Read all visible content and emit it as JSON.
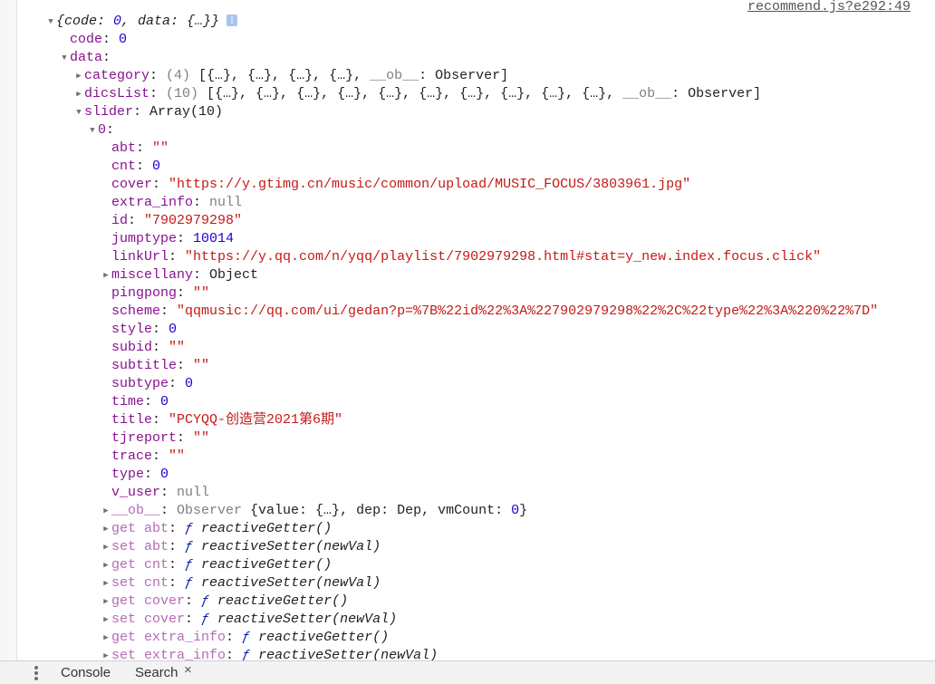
{
  "source_link": "recommend.js?e292:49",
  "rows": [
    {
      "level": 0,
      "toggle": "open",
      "info": true,
      "tokens": [
        [
          "{code: ",
          "it"
        ],
        [
          "0",
          "itnum"
        ],
        [
          ", data: {…}}",
          "it"
        ]
      ]
    },
    {
      "level": 1,
      "toggle": "none",
      "key": "code",
      "tokens": [
        [
          "0",
          "num"
        ]
      ]
    },
    {
      "level": 1,
      "toggle": "open",
      "key": "data",
      "tokens": []
    },
    {
      "level": 2,
      "toggle": "closed",
      "key": "category",
      "tokens": [
        [
          "(4)",
          "gray"
        ],
        [
          " [{…}, {…}, {…}, {…}, ",
          "plain"
        ],
        [
          "__ob__",
          "gray"
        ],
        [
          ": Observer]",
          "plain"
        ]
      ]
    },
    {
      "level": 2,
      "toggle": "closed",
      "key": "dicsList",
      "tokens": [
        [
          "(10)",
          "gray"
        ],
        [
          " [{…}, {…}, {…}, {…}, {…}, {…}, {…}, {…}, {…}, {…}, ",
          "plain"
        ],
        [
          "__ob__",
          "gray"
        ],
        [
          ": Observer]",
          "plain"
        ]
      ]
    },
    {
      "level": 2,
      "toggle": "open",
      "key": "slider",
      "tokens": [
        [
          "Array(10)",
          "plain"
        ]
      ]
    },
    {
      "level": 3,
      "toggle": "open",
      "key": "0",
      "tokens": []
    },
    {
      "level": 4,
      "toggle": "none",
      "key": "abt",
      "tokens": [
        [
          "\"\"",
          "str"
        ]
      ]
    },
    {
      "level": 4,
      "toggle": "none",
      "key": "cnt",
      "tokens": [
        [
          "0",
          "num"
        ]
      ]
    },
    {
      "level": 4,
      "toggle": "none",
      "key": "cover",
      "tokens": [
        [
          "\"https://y.gtimg.cn/music/common/upload/MUSIC_FOCUS/3803961.jpg\"",
          "str"
        ]
      ]
    },
    {
      "level": 4,
      "toggle": "none",
      "key": "extra_info",
      "tokens": [
        [
          "null",
          "null"
        ]
      ]
    },
    {
      "level": 4,
      "toggle": "none",
      "key": "id",
      "tokens": [
        [
          "\"7902979298\"",
          "str"
        ]
      ]
    },
    {
      "level": 4,
      "toggle": "none",
      "key": "jumptype",
      "tokens": [
        [
          "10014",
          "num"
        ]
      ]
    },
    {
      "level": 4,
      "toggle": "none",
      "key": "linkUrl",
      "tokens": [
        [
          "\"https://y.qq.com/n/yqq/playlist/7902979298.html#stat=y_new.index.focus.click\"",
          "str"
        ]
      ]
    },
    {
      "level": 4,
      "toggle": "closed",
      "key": "miscellany",
      "tokens": [
        [
          "Object",
          "plain"
        ]
      ]
    },
    {
      "level": 4,
      "toggle": "none",
      "key": "pingpong",
      "tokens": [
        [
          "\"\"",
          "str"
        ]
      ]
    },
    {
      "level": 4,
      "toggle": "none",
      "key": "scheme",
      "tokens": [
        [
          "\"qqmusic://qq.com/ui/gedan?p=%7B%22id%22%3A%227902979298%22%2C%22type%22%3A%220%22%7D\"",
          "str"
        ]
      ]
    },
    {
      "level": 4,
      "toggle": "none",
      "key": "style",
      "tokens": [
        [
          "0",
          "num"
        ]
      ]
    },
    {
      "level": 4,
      "toggle": "none",
      "key": "subid",
      "tokens": [
        [
          "\"\"",
          "str"
        ]
      ]
    },
    {
      "level": 4,
      "toggle": "none",
      "key": "subtitle",
      "tokens": [
        [
          "\"\"",
          "str"
        ]
      ]
    },
    {
      "level": 4,
      "toggle": "none",
      "key": "subtype",
      "tokens": [
        [
          "0",
          "num"
        ]
      ]
    },
    {
      "level": 4,
      "toggle": "none",
      "key": "time",
      "tokens": [
        [
          "0",
          "num"
        ]
      ]
    },
    {
      "level": 4,
      "toggle": "none",
      "key": "title",
      "tokens": [
        [
          "\"PCYQQ-创造营2021第6期\"",
          "str"
        ]
      ]
    },
    {
      "level": 4,
      "toggle": "none",
      "key": "tjreport",
      "tokens": [
        [
          "\"\"",
          "str"
        ]
      ]
    },
    {
      "level": 4,
      "toggle": "none",
      "key": "trace",
      "tokens": [
        [
          "\"\"",
          "str"
        ]
      ]
    },
    {
      "level": 4,
      "toggle": "none",
      "key": "type",
      "tokens": [
        [
          "0",
          "num"
        ]
      ]
    },
    {
      "level": 4,
      "toggle": "none",
      "key": "v_user",
      "tokens": [
        [
          "null",
          "null"
        ]
      ]
    },
    {
      "level": 4,
      "toggle": "closed",
      "key": "__ob__",
      "dim": true,
      "tokens": [
        [
          "Observer ",
          "gray"
        ],
        [
          "{value: {…}, dep: Dep, vmCount: ",
          "plain"
        ],
        [
          "0",
          "num"
        ],
        [
          "}",
          "plain"
        ]
      ]
    },
    {
      "level": 4,
      "toggle": "closed",
      "key": "get abt",
      "dim": true,
      "tokens": [
        [
          "ƒ ",
          "fn"
        ],
        [
          "reactiveGetter()",
          "it"
        ]
      ]
    },
    {
      "level": 4,
      "toggle": "closed",
      "key": "set abt",
      "dim": true,
      "tokens": [
        [
          "ƒ ",
          "fn"
        ],
        [
          "reactiveSetter(newVal)",
          "it"
        ]
      ]
    },
    {
      "level": 4,
      "toggle": "closed",
      "key": "get cnt",
      "dim": true,
      "tokens": [
        [
          "ƒ ",
          "fn"
        ],
        [
          "reactiveGetter()",
          "it"
        ]
      ]
    },
    {
      "level": 4,
      "toggle": "closed",
      "key": "set cnt",
      "dim": true,
      "tokens": [
        [
          "ƒ ",
          "fn"
        ],
        [
          "reactiveSetter(newVal)",
          "it"
        ]
      ]
    },
    {
      "level": 4,
      "toggle": "closed",
      "key": "get cover",
      "dim": true,
      "tokens": [
        [
          "ƒ ",
          "fn"
        ],
        [
          "reactiveGetter()",
          "it"
        ]
      ]
    },
    {
      "level": 4,
      "toggle": "closed",
      "key": "set cover",
      "dim": true,
      "tokens": [
        [
          "ƒ ",
          "fn"
        ],
        [
          "reactiveSetter(newVal)",
          "it"
        ]
      ]
    },
    {
      "level": 4,
      "toggle": "closed",
      "key": "get extra_info",
      "dim": true,
      "tokens": [
        [
          "ƒ ",
          "fn"
        ],
        [
          "reactiveGetter()",
          "it"
        ]
      ]
    },
    {
      "level": 4,
      "toggle": "closed",
      "key": "set extra_info",
      "dim": true,
      "tokens": [
        [
          "ƒ ",
          "fn"
        ],
        [
          "reactiveSetter(newVal)",
          "it"
        ]
      ]
    }
  ],
  "info_icon": "i",
  "drawer": {
    "menu_icon": "kebab-menu-icon",
    "tabs": [
      {
        "label": "Console"
      },
      {
        "label": "Search",
        "closable": true
      }
    ],
    "close_glyph": "×"
  }
}
